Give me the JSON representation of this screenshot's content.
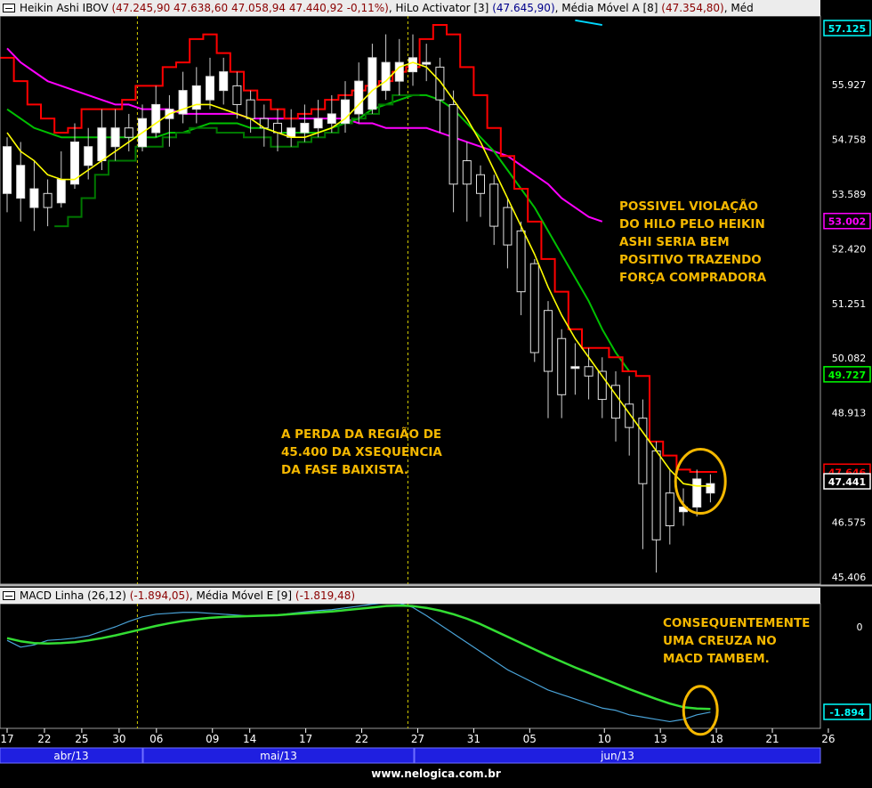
{
  "header_main": {
    "t1": "Heikin Ashi IBOV ",
    "v1": "(47.245,90  47.638,60  47.058,94  47.440,92  -0,11%)",
    "t2": ", HiLo Activator [3] ",
    "v2": "(47.645,90)",
    "t3": ", Média Móvel A [8] ",
    "v3": "(47.354,80)",
    "t4": ", Méd"
  },
  "header_macd": {
    "t1": "MACD Linha (26,12) ",
    "v1": "(-1.894,05)",
    "t2": ", Média Móvel E [9] ",
    "v2": "(-1.819,48)"
  },
  "annotations": {
    "note_top": [
      "POSSIVEL VIOLAÇÃO",
      "DO HILO PELO HEIKIN",
      "ASHI SERIA BEM",
      "POSITIVO TRAZENDO",
      "FORÇA COMPRADORA"
    ],
    "note_mid": [
      "A PERDA DA REGIÃO DE",
      "45.400 DA XSEQUENCIA",
      "DA FASE BAIXISTA."
    ],
    "note_macd": [
      "CONSEQUENTEMENTE",
      "UMA CREUZA NO",
      "MACD TAMBEM."
    ]
  },
  "footer": "www.nelogica.com.br",
  "colors": {
    "background": "#000000",
    "candle_up": "#ffffff",
    "hilo": "#ff0000",
    "hilo_buy": "#007700",
    "ma_short": "#ffff00",
    "ma_mid": "#00c000",
    "ma_long": "#ff00ff",
    "macd_line": "#4aa3d8",
    "macd_signal": "#33dd33",
    "annotation": "#f5b800",
    "month_band": "#1f1fe0"
  },
  "chart_data": [
    {
      "type": "candlestick",
      "title": "Heikin Ashi IBOV",
      "y_ticks": [
        57.125,
        55.927,
        54.758,
        53.589,
        52.42,
        51.251,
        50.082,
        48.913,
        47.646,
        46.575,
        45.406
      ],
      "y_tick_labels": [
        "57.125",
        "55.927",
        "54.758",
        "53.589",
        "52.420",
        "51.251",
        "50.082",
        "48.913",
        "47.646",
        "46.575",
        "45.406"
      ],
      "ylim": [
        45.406,
        57.125
      ],
      "price_badges": [
        {
          "label": "57.125",
          "value": 57.125,
          "color": "#00ffff"
        },
        {
          "label": "53.002",
          "value": 53.002,
          "color": "#ff00ff"
        },
        {
          "label": "49.727",
          "value": 49.727,
          "color": "#00ff00"
        },
        {
          "label": "47.646",
          "value": 47.646,
          "color": "#ff0000"
        },
        {
          "label": "47.441",
          "value": 47.441,
          "color": "#ffffff"
        }
      ],
      "candles": [
        {
          "o": 53.6,
          "c": 54.6,
          "h": 54.8,
          "l": 53.2
        },
        {
          "o": 53.5,
          "c": 54.2,
          "h": 54.7,
          "l": 53.0
        },
        {
          "o": 53.3,
          "c": 53.7,
          "h": 54.3,
          "l": 52.8
        },
        {
          "o": 53.6,
          "c": 53.3,
          "h": 53.9,
          "l": 52.9
        },
        {
          "o": 53.4,
          "c": 53.9,
          "h": 54.5,
          "l": 53.3
        },
        {
          "o": 53.8,
          "c": 54.7,
          "h": 55.1,
          "l": 53.7
        },
        {
          "o": 54.2,
          "c": 54.6,
          "h": 55.0,
          "l": 53.9
        },
        {
          "o": 54.3,
          "c": 55.0,
          "h": 55.4,
          "l": 54.1
        },
        {
          "o": 54.6,
          "c": 55.0,
          "h": 55.4,
          "l": 54.3
        },
        {
          "o": 55.0,
          "c": 54.8,
          "h": 55.3,
          "l": 54.5
        },
        {
          "o": 54.6,
          "c": 55.2,
          "h": 55.5,
          "l": 54.5
        },
        {
          "o": 54.9,
          "c": 55.5,
          "h": 55.9,
          "l": 54.8
        },
        {
          "o": 55.2,
          "c": 55.4,
          "h": 55.7,
          "l": 54.6
        },
        {
          "o": 55.3,
          "c": 55.8,
          "h": 56.2,
          "l": 55.1
        },
        {
          "o": 55.4,
          "c": 55.9,
          "h": 56.3,
          "l": 55.1
        },
        {
          "o": 55.6,
          "c": 56.1,
          "h": 56.5,
          "l": 55.4
        },
        {
          "o": 55.8,
          "c": 56.2,
          "h": 56.5,
          "l": 55.5
        },
        {
          "o": 55.9,
          "c": 55.5,
          "h": 56.2,
          "l": 55.2
        },
        {
          "o": 55.6,
          "c": 55.2,
          "h": 55.8,
          "l": 54.9
        },
        {
          "o": 55.2,
          "c": 55.0,
          "h": 55.5,
          "l": 54.6
        },
        {
          "o": 55.1,
          "c": 54.9,
          "h": 55.4,
          "l": 54.5
        },
        {
          "o": 54.8,
          "c": 55.0,
          "h": 55.4,
          "l": 54.6
        },
        {
          "o": 54.9,
          "c": 55.1,
          "h": 55.5,
          "l": 54.7
        },
        {
          "o": 55.0,
          "c": 55.2,
          "h": 55.6,
          "l": 54.8
        },
        {
          "o": 55.1,
          "c": 55.3,
          "h": 55.7,
          "l": 54.9
        },
        {
          "o": 55.1,
          "c": 55.6,
          "h": 56.0,
          "l": 54.9
        },
        {
          "o": 55.3,
          "c": 56.0,
          "h": 56.4,
          "l": 55.1
        },
        {
          "o": 55.4,
          "c": 56.5,
          "h": 56.8,
          "l": 55.3
        },
        {
          "o": 55.8,
          "c": 56.4,
          "h": 57.0,
          "l": 55.6
        },
        {
          "o": 56.0,
          "c": 56.4,
          "h": 56.9,
          "l": 55.7
        },
        {
          "o": 56.2,
          "c": 56.5,
          "h": 57.0,
          "l": 55.9
        },
        {
          "o": 56.4,
          "c": 56.4,
          "h": 56.8,
          "l": 56.0
        },
        {
          "o": 56.3,
          "c": 55.6,
          "h": 56.5,
          "l": 54.9
        },
        {
          "o": 55.5,
          "c": 53.8,
          "h": 55.8,
          "l": 53.2
        },
        {
          "o": 54.3,
          "c": 53.8,
          "h": 54.7,
          "l": 53.0
        },
        {
          "o": 54.0,
          "c": 53.6,
          "h": 54.2,
          "l": 53.1
        },
        {
          "o": 53.8,
          "c": 52.9,
          "h": 54.0,
          "l": 52.5
        },
        {
          "o": 53.3,
          "c": 52.5,
          "h": 53.5,
          "l": 52.0
        },
        {
          "o": 52.8,
          "c": 51.5,
          "h": 53.0,
          "l": 51.0
        },
        {
          "o": 52.1,
          "c": 50.2,
          "h": 52.2,
          "l": 50.0
        },
        {
          "o": 51.1,
          "c": 49.8,
          "h": 51.3,
          "l": 48.8
        },
        {
          "o": 50.5,
          "c": 49.3,
          "h": 50.7,
          "l": 48.8
        },
        {
          "o": 49.9,
          "c": 49.9,
          "h": 50.4,
          "l": 49.3
        },
        {
          "o": 49.9,
          "c": 49.7,
          "h": 50.3,
          "l": 49.2
        },
        {
          "o": 49.8,
          "c": 49.2,
          "h": 50.1,
          "l": 48.8
        },
        {
          "o": 49.5,
          "c": 48.8,
          "h": 49.8,
          "l": 48.3
        },
        {
          "o": 49.1,
          "c": 48.6,
          "h": 49.7,
          "l": 48.0
        },
        {
          "o": 48.8,
          "c": 47.4,
          "h": 49.2,
          "l": 46.0
        },
        {
          "o": 48.1,
          "c": 46.2,
          "h": 48.3,
          "l": 45.5
        },
        {
          "o": 47.2,
          "c": 46.5,
          "h": 47.7,
          "l": 46.1
        },
        {
          "o": 46.8,
          "c": 46.9,
          "h": 47.3,
          "l": 46.5
        },
        {
          "o": 46.9,
          "c": 47.5,
          "h": 47.7,
          "l": 46.7
        },
        {
          "o": 47.2,
          "c": 47.4,
          "h": 47.6,
          "l": 47.0
        }
      ],
      "series": [
        {
          "name": "HiLo Activator [3]",
          "values": [
            56.5,
            56.0,
            55.5,
            55.2,
            54.9,
            55.0,
            55.4,
            55.4,
            55.4,
            55.6,
            55.9,
            55.9,
            56.3,
            56.4,
            56.9,
            57.0,
            56.6,
            56.2,
            55.8,
            55.6,
            55.4,
            55.2,
            55.3,
            55.4,
            55.6,
            55.7,
            55.8,
            55.9,
            56.0,
            56.2,
            56.3,
            56.9,
            57.2,
            57.0,
            56.3,
            55.7,
            55.0,
            54.4,
            53.7,
            53.0,
            52.2,
            51.5,
            50.7,
            50.3,
            50.3,
            50.1,
            49.8,
            49.7,
            48.3,
            48.0,
            47.7,
            47.65,
            47.65
          ]
        },
        {
          "name": "HiLo buy",
          "values": [
            null,
            null,
            null,
            null,
            52.9,
            53.1,
            53.5,
            54.0,
            54.3,
            54.3,
            54.6,
            54.6,
            54.8,
            54.9,
            55.0,
            55.0,
            54.9,
            54.9,
            54.8,
            54.8,
            54.6,
            54.6,
            54.7,
            54.8,
            54.9,
            55.1,
            55.2,
            55.3,
            55.5,
            55.7,
            55.7,
            null,
            null,
            null,
            null,
            null,
            null,
            null,
            null,
            null,
            null,
            null,
            null,
            null,
            null,
            null,
            null,
            null,
            null,
            null,
            null,
            null,
            null
          ]
        },
        {
          "name": "Média Móvel A [8]",
          "values": [
            54.9,
            54.5,
            54.3,
            54.0,
            53.9,
            53.9,
            54.1,
            54.3,
            54.5,
            54.7,
            54.9,
            55.1,
            55.3,
            55.4,
            55.5,
            55.5,
            55.4,
            55.3,
            55.2,
            55.0,
            54.9,
            54.8,
            54.8,
            54.9,
            55.0,
            55.2,
            55.5,
            55.8,
            56.0,
            56.3,
            56.4,
            56.3,
            56.0,
            55.6,
            55.2,
            54.7,
            54.1,
            53.5,
            52.9,
            52.3,
            51.6,
            51.0,
            50.5,
            50.1,
            49.7,
            49.3,
            48.9,
            48.5,
            48.1,
            47.7,
            47.4,
            47.35,
            47.35
          ]
        },
        {
          "name": "Média Móvel",
          "values": [
            55.4,
            55.2,
            55.0,
            54.9,
            54.8,
            54.8,
            54.8,
            54.8,
            54.8,
            54.8,
            54.8,
            54.8,
            54.9,
            54.9,
            55.0,
            55.1,
            55.1,
            55.1,
            55.0,
            55.0,
            54.9,
            54.9,
            54.9,
            54.9,
            55.0,
            55.1,
            55.2,
            55.4,
            55.5,
            55.6,
            55.7,
            55.7,
            55.6,
            55.4,
            55.1,
            54.8,
            54.5,
            54.1,
            53.7,
            53.3,
            52.8,
            52.3,
            51.8,
            51.3,
            50.7,
            50.2,
            49.8
          ]
        },
        {
          "name": "Média Móvel",
          "values": [
            56.7,
            56.4,
            56.2,
            56.0,
            55.9,
            55.8,
            55.7,
            55.6,
            55.5,
            55.5,
            55.4,
            55.4,
            55.4,
            55.3,
            55.3,
            55.3,
            55.3,
            55.3,
            55.2,
            55.2,
            55.2,
            55.2,
            55.2,
            55.2,
            55.2,
            55.2,
            55.1,
            55.1,
            55.0,
            55.0,
            55.0,
            55.0,
            54.9,
            54.8,
            54.7,
            54.6,
            54.5,
            54.4,
            54.2,
            54.0,
            53.8,
            53.5,
            53.3,
            53.1,
            53.0
          ]
        },
        {
          "name": "Média Móvel",
          "values": [
            null,
            null,
            null,
            null,
            null,
            null,
            null,
            null,
            null,
            null,
            null,
            null,
            null,
            null,
            null,
            null,
            null,
            null,
            null,
            null,
            null,
            null,
            null,
            null,
            null,
            null,
            null,
            null,
            null,
            null,
            null,
            null,
            null,
            null,
            null,
            null,
            null,
            null,
            null,
            null,
            null,
            null,
            57.3,
            57.25,
            57.2
          ]
        }
      ]
    },
    {
      "type": "line",
      "title": "MACD Linha (26,12)",
      "y_ticks": [
        0
      ],
      "y_tick_labels": [
        "0"
      ],
      "ylim": [
        -2.3,
        0.55
      ],
      "price_badges": [
        {
          "label": "-1.894",
          "value": -1.894,
          "color": "#00ffff"
        }
      ],
      "series": [
        {
          "name": "MACD Linha (26,12)",
          "values": [
            -0.3,
            -0.45,
            -0.4,
            -0.3,
            -0.28,
            -0.25,
            -0.2,
            -0.1,
            0.0,
            0.12,
            0.22,
            0.28,
            0.3,
            0.32,
            0.32,
            0.3,
            0.28,
            0.26,
            0.24,
            0.24,
            0.26,
            0.3,
            0.33,
            0.36,
            0.38,
            0.42,
            0.46,
            0.5,
            0.53,
            0.52,
            0.43,
            0.25,
            0.05,
            -0.15,
            -0.35,
            -0.55,
            -0.75,
            -0.95,
            -1.1,
            -1.25,
            -1.4,
            -1.5,
            -1.6,
            -1.7,
            -1.8,
            -1.85,
            -1.95,
            -2.0,
            -2.05,
            -2.1,
            -2.05,
            -1.95,
            -1.89
          ]
        },
        {
          "name": "Média Móvel E [9]",
          "values": [
            -0.25,
            -0.32,
            -0.36,
            -0.37,
            -0.36,
            -0.34,
            -0.3,
            -0.25,
            -0.19,
            -0.12,
            -0.05,
            0.02,
            0.08,
            0.13,
            0.17,
            0.2,
            0.22,
            0.23,
            0.24,
            0.25,
            0.26,
            0.28,
            0.3,
            0.32,
            0.34,
            0.37,
            0.4,
            0.43,
            0.46,
            0.47,
            0.46,
            0.42,
            0.36,
            0.28,
            0.18,
            0.06,
            -0.08,
            -0.22,
            -0.36,
            -0.5,
            -0.64,
            -0.77,
            -0.9,
            -1.02,
            -1.14,
            -1.26,
            -1.38,
            -1.49,
            -1.6,
            -1.7,
            -1.78,
            -1.81,
            -1.82
          ]
        }
      ],
      "x_ticks": [
        {
          "label": "17",
          "index": 0
        },
        {
          "label": "22",
          "index": 2
        },
        {
          "label": "25",
          "index": 4
        },
        {
          "label": "30",
          "index": 6
        },
        {
          "label": "06",
          "index": 8
        },
        {
          "label": "09",
          "index": 11
        },
        {
          "label": "14",
          "index": 13
        },
        {
          "label": "17",
          "index": 16
        },
        {
          "label": "22",
          "index": 19
        },
        {
          "label": "27",
          "index": 22
        },
        {
          "label": "31",
          "index": 25
        },
        {
          "label": "05",
          "index": 28
        },
        {
          "label": "10",
          "index": 32
        },
        {
          "label": "13",
          "index": 35
        },
        {
          "label": "18",
          "index": 38
        },
        {
          "label": "21",
          "index": 41
        },
        {
          "label": "26",
          "index": 44
        }
      ],
      "months": [
        "abr/13",
        "mai/13",
        "jun/13"
      ]
    }
  ]
}
